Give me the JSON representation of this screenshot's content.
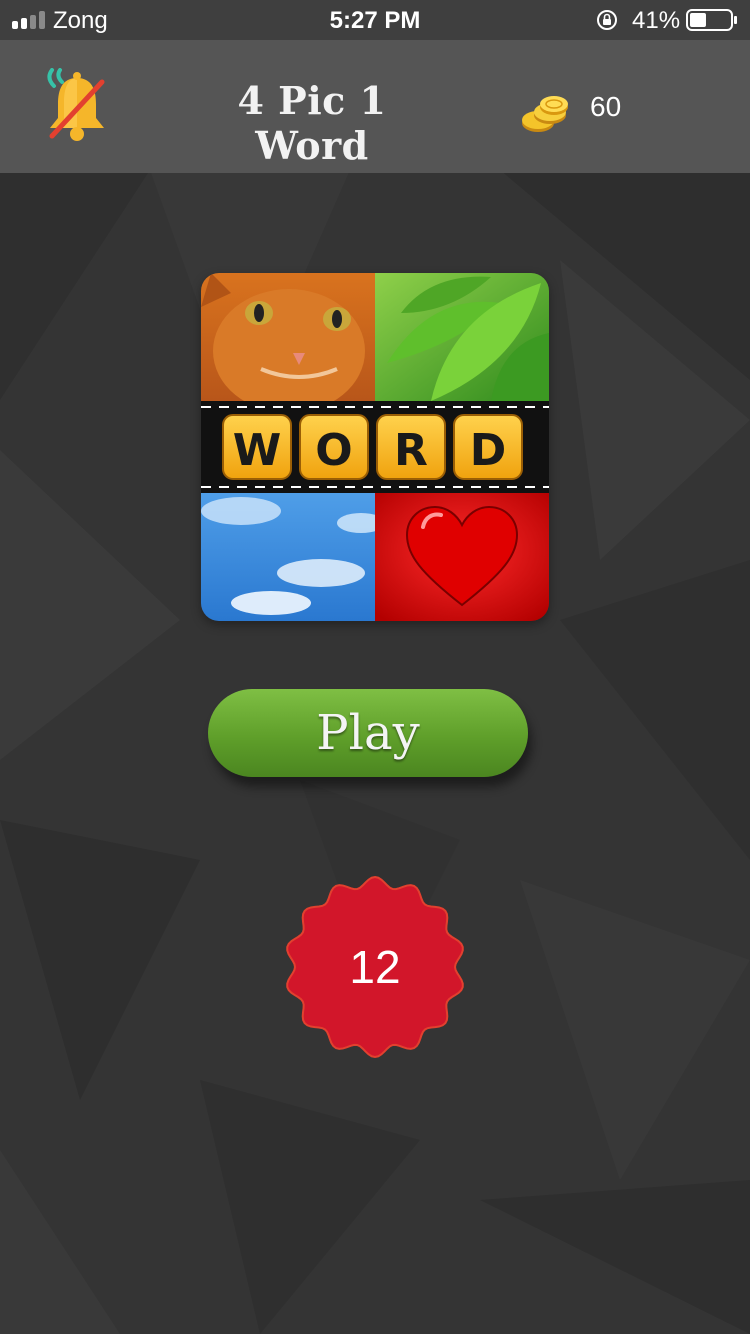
{
  "status_bar": {
    "carrier": "Zong",
    "time": "5:27 PM",
    "battery_percent": "41%",
    "battery_level": 0.41
  },
  "header": {
    "title": "4 Pic 1 Word",
    "coins": "60",
    "sound_icon": "bell-muted-icon",
    "coins_icon": "coins-icon"
  },
  "logo": {
    "word_tiles": [
      "W",
      "O",
      "R",
      "D"
    ]
  },
  "play_button": {
    "label": "Play"
  },
  "level_badge": {
    "value": "12"
  },
  "colors": {
    "background": "#333333",
    "header": "#555555",
    "play_green": "#5f9f2a",
    "badge_red": "#d2162a",
    "tile_yellow": "#f6b51d"
  }
}
